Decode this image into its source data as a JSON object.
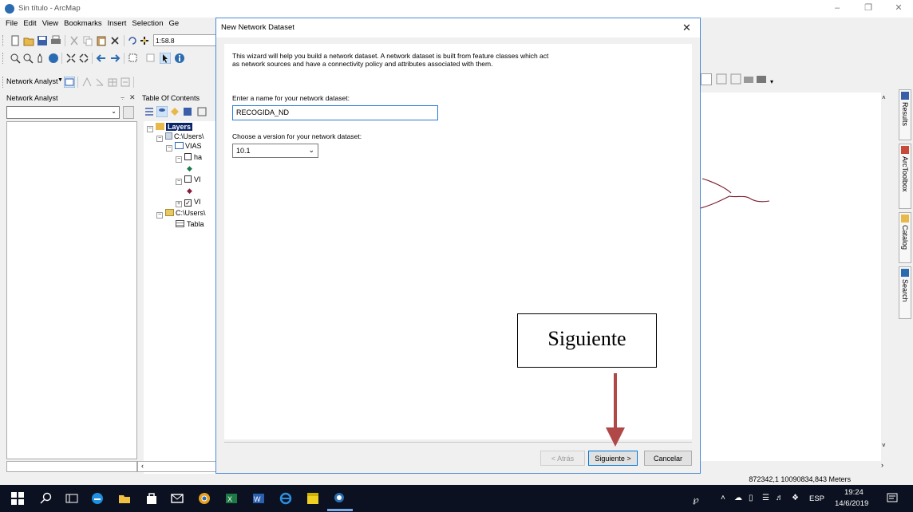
{
  "window": {
    "title": "Sin título - ArcMap",
    "controls": [
      "minimize",
      "restore",
      "close"
    ]
  },
  "menubar": [
    "File",
    "Edit",
    "View",
    "Bookmarks",
    "Insert",
    "Selection",
    "Ge"
  ],
  "toolbar": {
    "scale_value": "1:58.8",
    "network_analyst_label": "Network Analyst"
  },
  "panels": {
    "network_analyst": {
      "title": "Network Analyst"
    },
    "toc": {
      "title": "Table Of Contents",
      "tree": [
        {
          "label": "Layers"
        },
        {
          "label": "C:\\Users\\"
        },
        {
          "label": "VIAS"
        },
        {
          "label": "ha"
        },
        {
          "label": "VI"
        },
        {
          "label": "VI"
        },
        {
          "label": "C:\\Users\\"
        },
        {
          "label": "Tabla"
        }
      ]
    }
  },
  "dock_tabs": [
    "Results",
    "ArcToolbox",
    "Catalog",
    "Search"
  ],
  "status": {
    "coordinates": "872342,1 10090834,843 Meters"
  },
  "dialog": {
    "title": "New Network Dataset",
    "intro": "This wizard will help you build a network dataset. A network dataset is built from feature classes which act as network sources and have a connectivity policy and attributes associated with them.",
    "name_label": "Enter a name for your network dataset:",
    "name_value": "RECOGIDA_ND",
    "version_label": "Choose a version for your network dataset:",
    "version_value": "10.1",
    "buttons": {
      "back": "< Atrás",
      "next": "Siguiente >",
      "cancel": "Cancelar"
    }
  },
  "annotation": {
    "label": "Siguiente",
    "arrow_color": "#b04848"
  },
  "taskbar": {
    "language": "ESP",
    "time": "19:24",
    "date": "14/6/2019"
  },
  "colors": {
    "accent": "#0078d7",
    "taskbar": "#0b1120",
    "selection": "#0a246a"
  }
}
